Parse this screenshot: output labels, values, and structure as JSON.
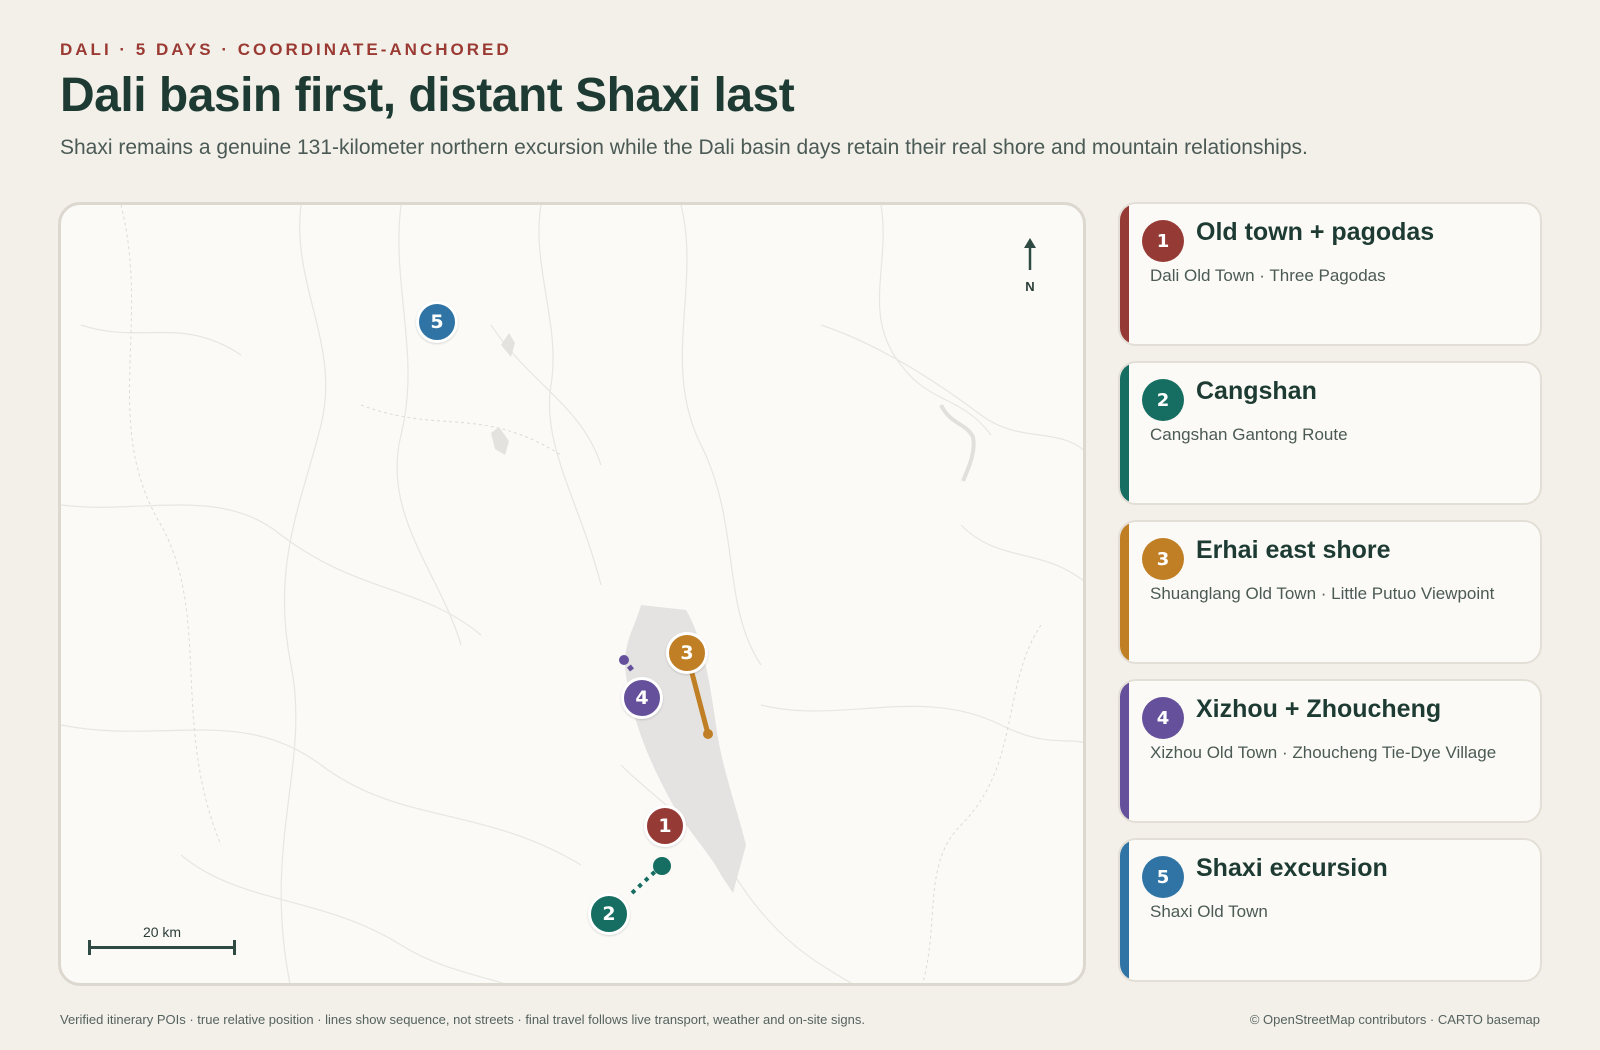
{
  "header": {
    "eyebrow": "DALI · 5 DAYS · COORDINATE-ANCHORED",
    "title": "Dali basin first, distant Shaxi last",
    "subtitle": "Shaxi remains a genuine 131-kilometer northern excursion while the Dali basin days retain their real shore and mountain relationships."
  },
  "map": {
    "north_label": "N",
    "scale_label": "20 km",
    "markers": [
      {
        "number": "1",
        "color": "#963a35"
      },
      {
        "number": "2",
        "color": "#166d61"
      },
      {
        "number": "3",
        "color": "#c07f25"
      },
      {
        "number": "4",
        "color": "#65509b"
      },
      {
        "number": "5",
        "color": "#2f74a4"
      }
    ]
  },
  "days": [
    {
      "number": "1",
      "title": "Old town + pagodas",
      "places": "Dali Old Town · Three Pagodas",
      "color": "#963a35"
    },
    {
      "number": "2",
      "title": "Cangshan",
      "places": "Cangshan Gantong Route",
      "color": "#166d61"
    },
    {
      "number": "3",
      "title": "Erhai east shore",
      "places": "Shuanglang Old Town · Little Putuo Viewpoint",
      "color": "#c07f25"
    },
    {
      "number": "4",
      "title": "Xizhou + Zhoucheng",
      "places": "Xizhou Old Town · Zhoucheng Tie-Dye Village",
      "color": "#65509b"
    },
    {
      "number": "5",
      "title": "Shaxi excursion",
      "places": "Shaxi Old Town",
      "color": "#2f74a4"
    }
  ],
  "footer": {
    "note": "Verified itinerary POIs · true relative position · lines show sequence, not streets · final travel follows live transport, weather and on-site signs.",
    "attribution": "© OpenStreetMap contributors · CARTO basemap"
  }
}
